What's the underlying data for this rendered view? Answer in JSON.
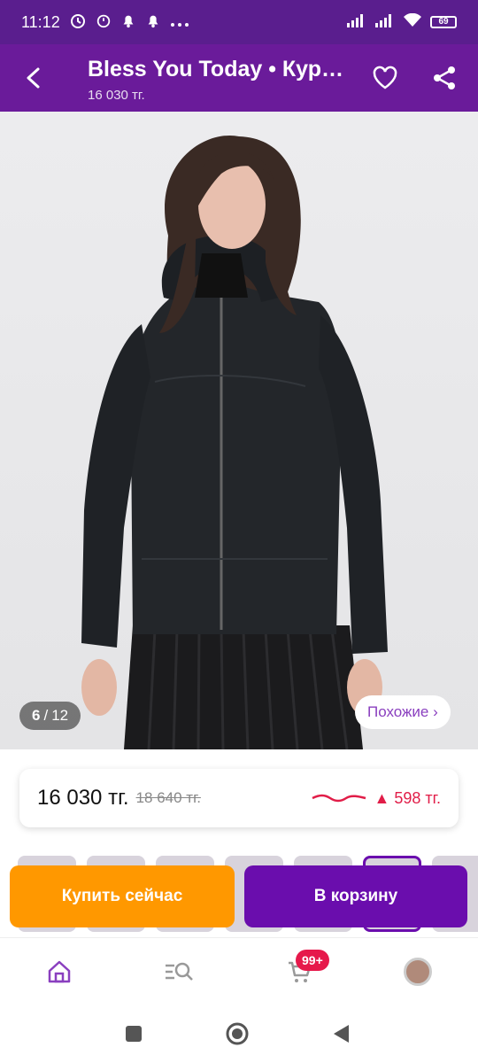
{
  "status_bar": {
    "time": "11:12",
    "left_icons": [
      "alarm-clock-icon",
      "alarm-icon",
      "bell-icon",
      "bell-icon",
      "more-dots-icon"
    ],
    "right_icons": [
      "signal-icon",
      "signal-icon",
      "wifi-icon"
    ],
    "battery": "69"
  },
  "header": {
    "title": "Bless You Today • Кур…",
    "price": "16 030 тг.",
    "accent_color": "#6a1b9a"
  },
  "gallery": {
    "current_index": "6",
    "separator": "/",
    "total": "12",
    "similar_label": "Похожие ›"
  },
  "price_card": {
    "current": "16 030 тг.",
    "old": "18 640 тг.",
    "change": "▲ 598 тг.",
    "change_color": "#e11d48"
  },
  "actions": {
    "buy_now": "Купить сейчас",
    "add_to_cart": "В корзину",
    "buy_color": "#ff9800",
    "cart_color": "#6a0dad"
  },
  "bottom_nav": {
    "items": [
      "home-icon",
      "catalog-search-icon",
      "cart-icon",
      "profile-avatar"
    ],
    "cart_badge": "99+"
  },
  "system_nav": [
    "recents-button",
    "home-button",
    "back-button"
  ]
}
